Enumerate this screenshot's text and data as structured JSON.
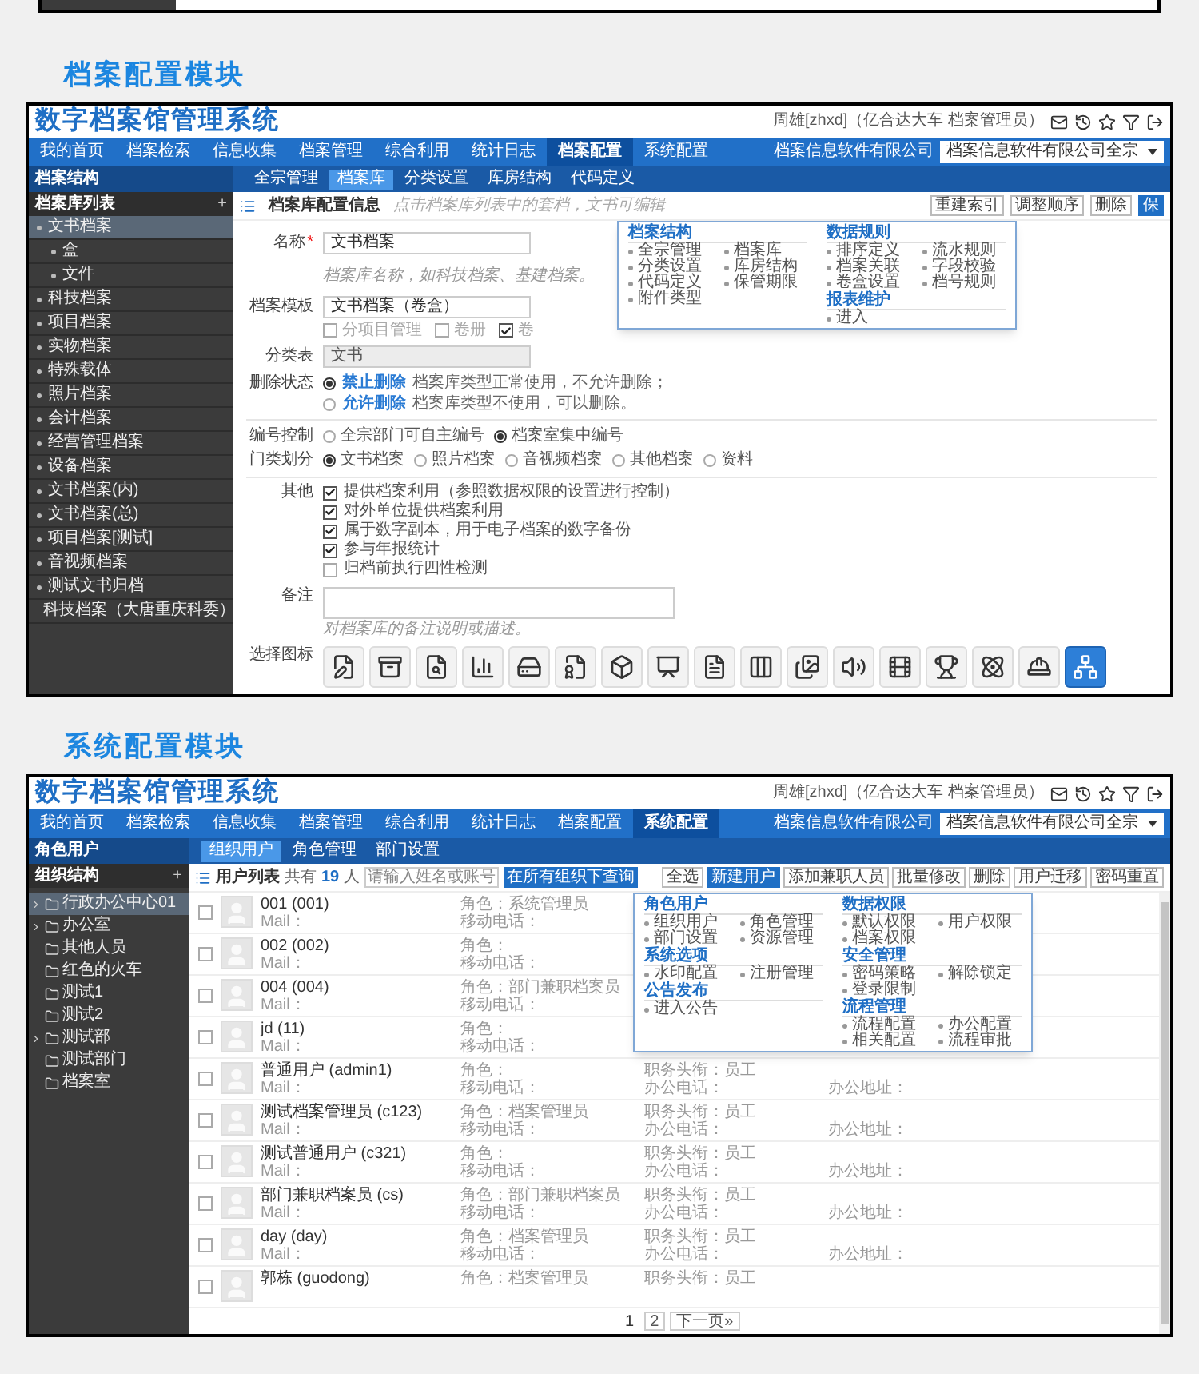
{
  "archive_config": {
    "heading": "档案配置模块",
    "header": {
      "logo": "数字档案馆管理系统",
      "user": "周雄[zhxd]（亿合达大车 档案管理员）"
    },
    "nav": {
      "items": [
        {
          "label": "我的首页",
          "selected": false
        },
        {
          "label": "档案检索",
          "selected": false
        },
        {
          "label": "信息收集",
          "selected": false
        },
        {
          "label": "档案管理",
          "selected": false
        },
        {
          "label": "综合利用",
          "selected": false
        },
        {
          "label": "统计日志",
          "selected": false
        },
        {
          "label": "档案配置",
          "selected": true
        },
        {
          "label": "系统配置",
          "selected": false
        }
      ],
      "company": "档案信息软件有限公司",
      "fonds_select": "档案信息软件有限公司全宗"
    },
    "subnav": {
      "title": "档案结构",
      "tabs": [
        {
          "label": "全宗管理",
          "selected": false
        },
        {
          "label": "档案库",
          "selected": true
        },
        {
          "label": "分类设置",
          "selected": false
        },
        {
          "label": "库房结构",
          "selected": false
        },
        {
          "label": "代码定义",
          "selected": false
        }
      ]
    },
    "sidebar": {
      "title": "档案库列表",
      "add": "+",
      "items": [
        {
          "label": "文书档案",
          "selected": true,
          "children": [
            {
              "label": "盒",
              "selected": false
            },
            {
              "label": "文件",
              "selected": false
            }
          ]
        },
        {
          "label": "科技档案",
          "selected": false
        },
        {
          "label": "项目档案",
          "selected": false
        },
        {
          "label": "实物档案",
          "selected": false
        },
        {
          "label": "特殊载体",
          "selected": false
        },
        {
          "label": "照片档案",
          "selected": false
        },
        {
          "label": "会计档案",
          "selected": false
        },
        {
          "label": "经营管理档案",
          "selected": false
        },
        {
          "label": "设备档案",
          "selected": false
        },
        {
          "label": "文书档案(内)",
          "selected": false
        },
        {
          "label": "文书档案(总)",
          "selected": false
        },
        {
          "label": "项目档案[测试]",
          "selected": false
        },
        {
          "label": "音视频档案",
          "selected": false
        },
        {
          "label": "测试文书归档",
          "selected": false
        },
        {
          "label": "科技档案（大唐重庆科委）",
          "selected": false
        }
      ]
    },
    "toolbar": {
      "title": "档案库配置信息",
      "hint": "点击档案库列表中的套档，文书可编辑",
      "buttons": [
        {
          "label": "重建索引",
          "primary": false
        },
        {
          "label": "调整顺序",
          "primary": false
        },
        {
          "label": "删除",
          "primary": false
        },
        {
          "label": "保",
          "primary": true
        }
      ]
    },
    "form": [
      {
        "kind": "text",
        "label": "名称",
        "mark": "*",
        "value": "文书档案",
        "hint": "档案库名称，如科技档案、基建档案。"
      },
      {
        "kind": "select",
        "label": "档案模板",
        "value": "文书档案（卷盒）",
        "options": [
          {
            "label": "分项目管理",
            "checked": false
          },
          {
            "label": "卷册",
            "checked": false
          },
          {
            "label": "卷",
            "checked": true
          }
        ]
      },
      {
        "kind": "readonly",
        "label": "分类表",
        "value": "文书"
      },
      {
        "kind": "radio-list",
        "label": "删除状态",
        "options": [
          {
            "label": "禁止删除",
            "note": "档案库类型正常使用，不允许删除；",
            "selected": true
          },
          {
            "label": "允许删除",
            "note": "档案库类型不使用，可以删除。",
            "selected": false
          }
        ]
      },
      {
        "kind": "divider"
      },
      {
        "kind": "radio-inline",
        "label": "编号控制",
        "options": [
          {
            "label": "全宗部门可自主编号",
            "selected": false
          },
          {
            "label": "档案室集中编号",
            "selected": true
          }
        ]
      },
      {
        "kind": "radio-inline",
        "label": "门类划分",
        "options": [
          {
            "label": "文书档案",
            "selected": true
          },
          {
            "label": "照片档案",
            "selected": false
          },
          {
            "label": "音视频档案",
            "selected": false
          },
          {
            "label": "其他档案",
            "selected": false
          },
          {
            "label": "资料",
            "selected": false
          }
        ]
      },
      {
        "kind": "divider"
      },
      {
        "kind": "checklist",
        "label": "其他",
        "options": [
          {
            "label": "提供档案利用（参照数据权限的设置进行控制）",
            "checked": true
          },
          {
            "label": "对外单位提供档案利用",
            "checked": true
          },
          {
            "label": "属于数字副本，用于电子档案的数字备份",
            "checked": true
          },
          {
            "label": "参与年报统计",
            "checked": true
          },
          {
            "label": "归档前执行四性检测",
            "checked": false
          }
        ]
      },
      {
        "kind": "textarea",
        "label": "备注",
        "hint": "对档案库的备注说明或描述。"
      },
      {
        "kind": "icons",
        "label": "选择图标",
        "icons": [
          {
            "kind": "pen-doc",
            "selected": false
          },
          {
            "kind": "cabinet",
            "selected": false
          },
          {
            "kind": "search-doc",
            "selected": false
          },
          {
            "kind": "bars",
            "selected": false
          },
          {
            "kind": "disk",
            "selected": false
          },
          {
            "kind": "cert-doc",
            "selected": false
          },
          {
            "kind": "cube",
            "selected": false
          },
          {
            "kind": "presenter",
            "selected": false
          },
          {
            "kind": "doc",
            "selected": false
          },
          {
            "kind": "ledger",
            "selected": false
          },
          {
            "kind": "pictures",
            "selected": false
          },
          {
            "kind": "audio",
            "selected": false
          },
          {
            "kind": "film",
            "selected": false
          },
          {
            "kind": "trophy",
            "selected": false
          },
          {
            "kind": "atom",
            "selected": false
          },
          {
            "kind": "worker",
            "selected": false
          },
          {
            "kind": "org",
            "selected": true
          }
        ]
      }
    ],
    "dropdown": {
      "columns": [
        [
          {
            "title": "档案结构",
            "items": [
              "全宗管理",
              "档案库",
              "分类设置",
              "库房结构",
              "代码定义",
              "保管期限",
              "附件类型"
            ]
          }
        ],
        [
          {
            "title": "数据规则",
            "items": [
              "排序定义",
              "流水规则",
              "档案关联",
              "字段校验",
              "卷盒设置",
              "档号规则"
            ]
          },
          {
            "title": "报表维护",
            "items": [
              "进入"
            ]
          }
        ]
      ]
    }
  },
  "system_config": {
    "heading": "系统配置模块",
    "header": {
      "logo": "数字档案馆管理系统",
      "user": "周雄[zhxd]（亿合达大车 档案管理员）"
    },
    "nav": {
      "items": [
        {
          "label": "我的首页",
          "selected": false
        },
        {
          "label": "档案检索",
          "selected": false
        },
        {
          "label": "信息收集",
          "selected": false
        },
        {
          "label": "档案管理",
          "selected": false
        },
        {
          "label": "综合利用",
          "selected": false
        },
        {
          "label": "统计日志",
          "selected": false
        },
        {
          "label": "档案配置",
          "selected": false
        },
        {
          "label": "系统配置",
          "selected": true
        }
      ],
      "company": "档案信息软件有限公司",
      "fonds_select": "档案信息软件有限公司全宗"
    },
    "subnav": {
      "title": "角色用户",
      "tabs": [
        {
          "label": "组织用户",
          "selected": true
        },
        {
          "label": "角色管理",
          "selected": false
        },
        {
          "label": "部门设置",
          "selected": false
        }
      ]
    },
    "sidebar": {
      "title": "组织结构",
      "add": "+",
      "items": [
        {
          "label": "行政办公中心01",
          "kind": "branch",
          "selected": true
        },
        {
          "label": "办公室",
          "kind": "branch",
          "selected": false
        },
        {
          "label": "其他人员",
          "kind": "leaf",
          "selected": false
        },
        {
          "label": "红色的火车",
          "kind": "leaf",
          "selected": false
        },
        {
          "label": "测试1",
          "kind": "leaf",
          "selected": false
        },
        {
          "label": "测试2",
          "kind": "leaf",
          "selected": false
        },
        {
          "label": "测试部",
          "kind": "branch",
          "selected": false
        },
        {
          "label": "测试部门",
          "kind": "leaf",
          "selected": false
        },
        {
          "label": "档案室",
          "kind": "leaf",
          "selected": false
        }
      ]
    },
    "toolbar": {
      "title": "用户列表",
      "total_label": "共有",
      "total": "19",
      "unit": "人",
      "search_placeholder": "请输入姓名或账号",
      "search_button": "在所有组织下查询",
      "buttons": [
        {
          "label": "全选",
          "primary": false
        },
        {
          "label": "新建用户",
          "primary": true
        },
        {
          "label": "添加兼职人员",
          "primary": false
        },
        {
          "label": "批量修改",
          "primary": false
        },
        {
          "label": "删除",
          "primary": false
        },
        {
          "label": "用户迁移",
          "primary": false
        },
        {
          "label": "密码重置",
          "primary": false
        }
      ]
    },
    "users": [
      {
        "checked": false,
        "name": "001 (001)",
        "mail": "Mail：",
        "role": "角色：系统管理员",
        "mobile": "移动电话："
      },
      {
        "checked": false,
        "name": "002 (002)",
        "mail": "Mail：",
        "role": "角色：",
        "mobile": "移动电话："
      },
      {
        "checked": false,
        "name": "004 (004)",
        "mail": "Mail：",
        "role": "角色：部门兼职档案员",
        "mobile": "移动电话："
      },
      {
        "checked": false,
        "name": "jd (11)",
        "mail": "Mail：",
        "role": "角色：",
        "mobile": "移动电话："
      },
      {
        "checked": false,
        "name": "普通用户 (admin1)",
        "mail": "Mail：",
        "role": "角色：",
        "mobile": "移动电话：",
        "title": "职务头衔：员工",
        "office_phone": "办公电话：",
        "office_address": "办公地址："
      },
      {
        "checked": false,
        "name": "测试档案管理员 (c123)",
        "mail": "Mail：",
        "role": "角色：档案管理员",
        "mobile": "移动电话：",
        "title": "职务头衔：员工",
        "office_phone": "办公电话：",
        "office_address": "办公地址："
      },
      {
        "checked": false,
        "name": "测试普通用户 (c321)",
        "mail": "Mail：",
        "role": "角色：",
        "mobile": "移动电话：",
        "title": "职务头衔：员工",
        "office_phone": "办公电话：",
        "office_address": "办公地址："
      },
      {
        "checked": false,
        "name": "部门兼职档案员 (cs)",
        "mail": "Mail：",
        "role": "角色：部门兼职档案员",
        "mobile": "移动电话：",
        "title": "职务头衔：员工",
        "office_phone": "办公电话：",
        "office_address": "办公地址："
      },
      {
        "checked": false,
        "name": "day (day)",
        "mail": "Mail：",
        "role": "角色：档案管理员",
        "mobile": "移动电话：",
        "title": "职务头衔：员工",
        "office_phone": "办公电话：",
        "office_address": "办公地址："
      },
      {
        "checked": false,
        "name": "郭栋 (guodong)",
        "role": "角色：档案管理员",
        "title": "职务头衔：员工"
      }
    ],
    "pagination": {
      "pages": [
        {
          "label": "1",
          "selected": true
        },
        {
          "label": "2",
          "selected": false
        }
      ],
      "next": "下一页»"
    },
    "dropdown": {
      "columns": [
        [
          {
            "title": "角色用户",
            "items": [
              "组织用户",
              "角色管理",
              "部门设置",
              "资源管理"
            ]
          },
          {
            "title": "系统选项",
            "items": [
              "水印配置",
              "注册管理"
            ]
          },
          {
            "title": "公告发布",
            "items": [
              "进入公告"
            ]
          }
        ],
        [
          {
            "title": "数据权限",
            "items": [
              "默认权限",
              "用户权限",
              "档案权限"
            ]
          },
          {
            "title": "安全管理",
            "items": [
              "密码策略",
              "解除锁定",
              "登录限制"
            ]
          },
          {
            "title": "流程管理",
            "items": [
              "流程配置",
              "办公配置",
              "相关配置",
              "流程审批"
            ]
          }
        ]
      ]
    }
  }
}
